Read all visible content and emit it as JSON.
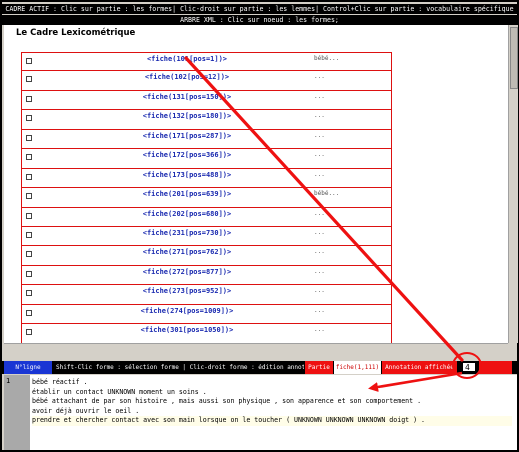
{
  "header": {
    "line1": "CADRE ACTIF : Clic sur partie : les formes| Clic-droit sur partie : les lemmes| Control+Clic sur partie : vocabulaire spécifique",
    "line2": "ARBRE XML : Clic sur noeud : les formes;"
  },
  "panel": {
    "title": "Le Cadre Lexicométrique",
    "rows": [
      {
        "label": "<fiche(101[pos=1])>",
        "value": "bébé..."
      },
      {
        "label": "<fiche(102[pos=12])>",
        "value": "..."
      },
      {
        "label": "<fiche(131[pos=150])>",
        "value": "..."
      },
      {
        "label": "<fiche(132[pos=180])>",
        "value": "..."
      },
      {
        "label": "<fiche(171[pos=287])>",
        "value": "..."
      },
      {
        "label": "<fiche(172[pos=366])>",
        "value": "..."
      },
      {
        "label": "<fiche(173[pos=488])>",
        "value": "..."
      },
      {
        "label": "<fiche(201[pos=639])>",
        "value": "bébé..."
      },
      {
        "label": "<fiche(202[pos=680])>",
        "value": "..."
      },
      {
        "label": "<fiche(231[pos=730])>",
        "value": "..."
      },
      {
        "label": "<fiche(271[pos=762])>",
        "value": "..."
      },
      {
        "label": "<fiche(272[pos=877])>",
        "value": "..."
      },
      {
        "label": "<fiche(273[pos=952])>",
        "value": "..."
      },
      {
        "label": "<fiche(274[pos=1009])>",
        "value": "..."
      },
      {
        "label": "<fiche(301[pos=1050])>",
        "value": "..."
      }
    ]
  },
  "status": {
    "nligne": "N°ligne",
    "help": "Shift-Clic forme : sélection forme | Clic-droit forme : édition annotations",
    "partie": "Partie",
    "fiche": "fiche(1,111)",
    "annotation_label": "Annotation affichée",
    "annotation_value": "4"
  },
  "text_area": {
    "line_number": "1",
    "lines": [
      "bébé réactif .",
      "établir un contact UNKNOWN moment un soins .",
      "bébé attachant de par son histoire , mais aussi son physique , son apparence et son comportement .",
      "avoir déjà ouvrir le oeil .",
      "prendre et chercher contact avec son main lorsque on le toucher ( UNKNOWN UNKNOWN UNKNOWN doigt ) ."
    ]
  },
  "colors": {
    "row_border": "#dd1111",
    "label_blue": "#1a2ab0",
    "status_red": "#ee1111",
    "nligne_blue": "#1a36d4",
    "arrow": "#e11"
  }
}
